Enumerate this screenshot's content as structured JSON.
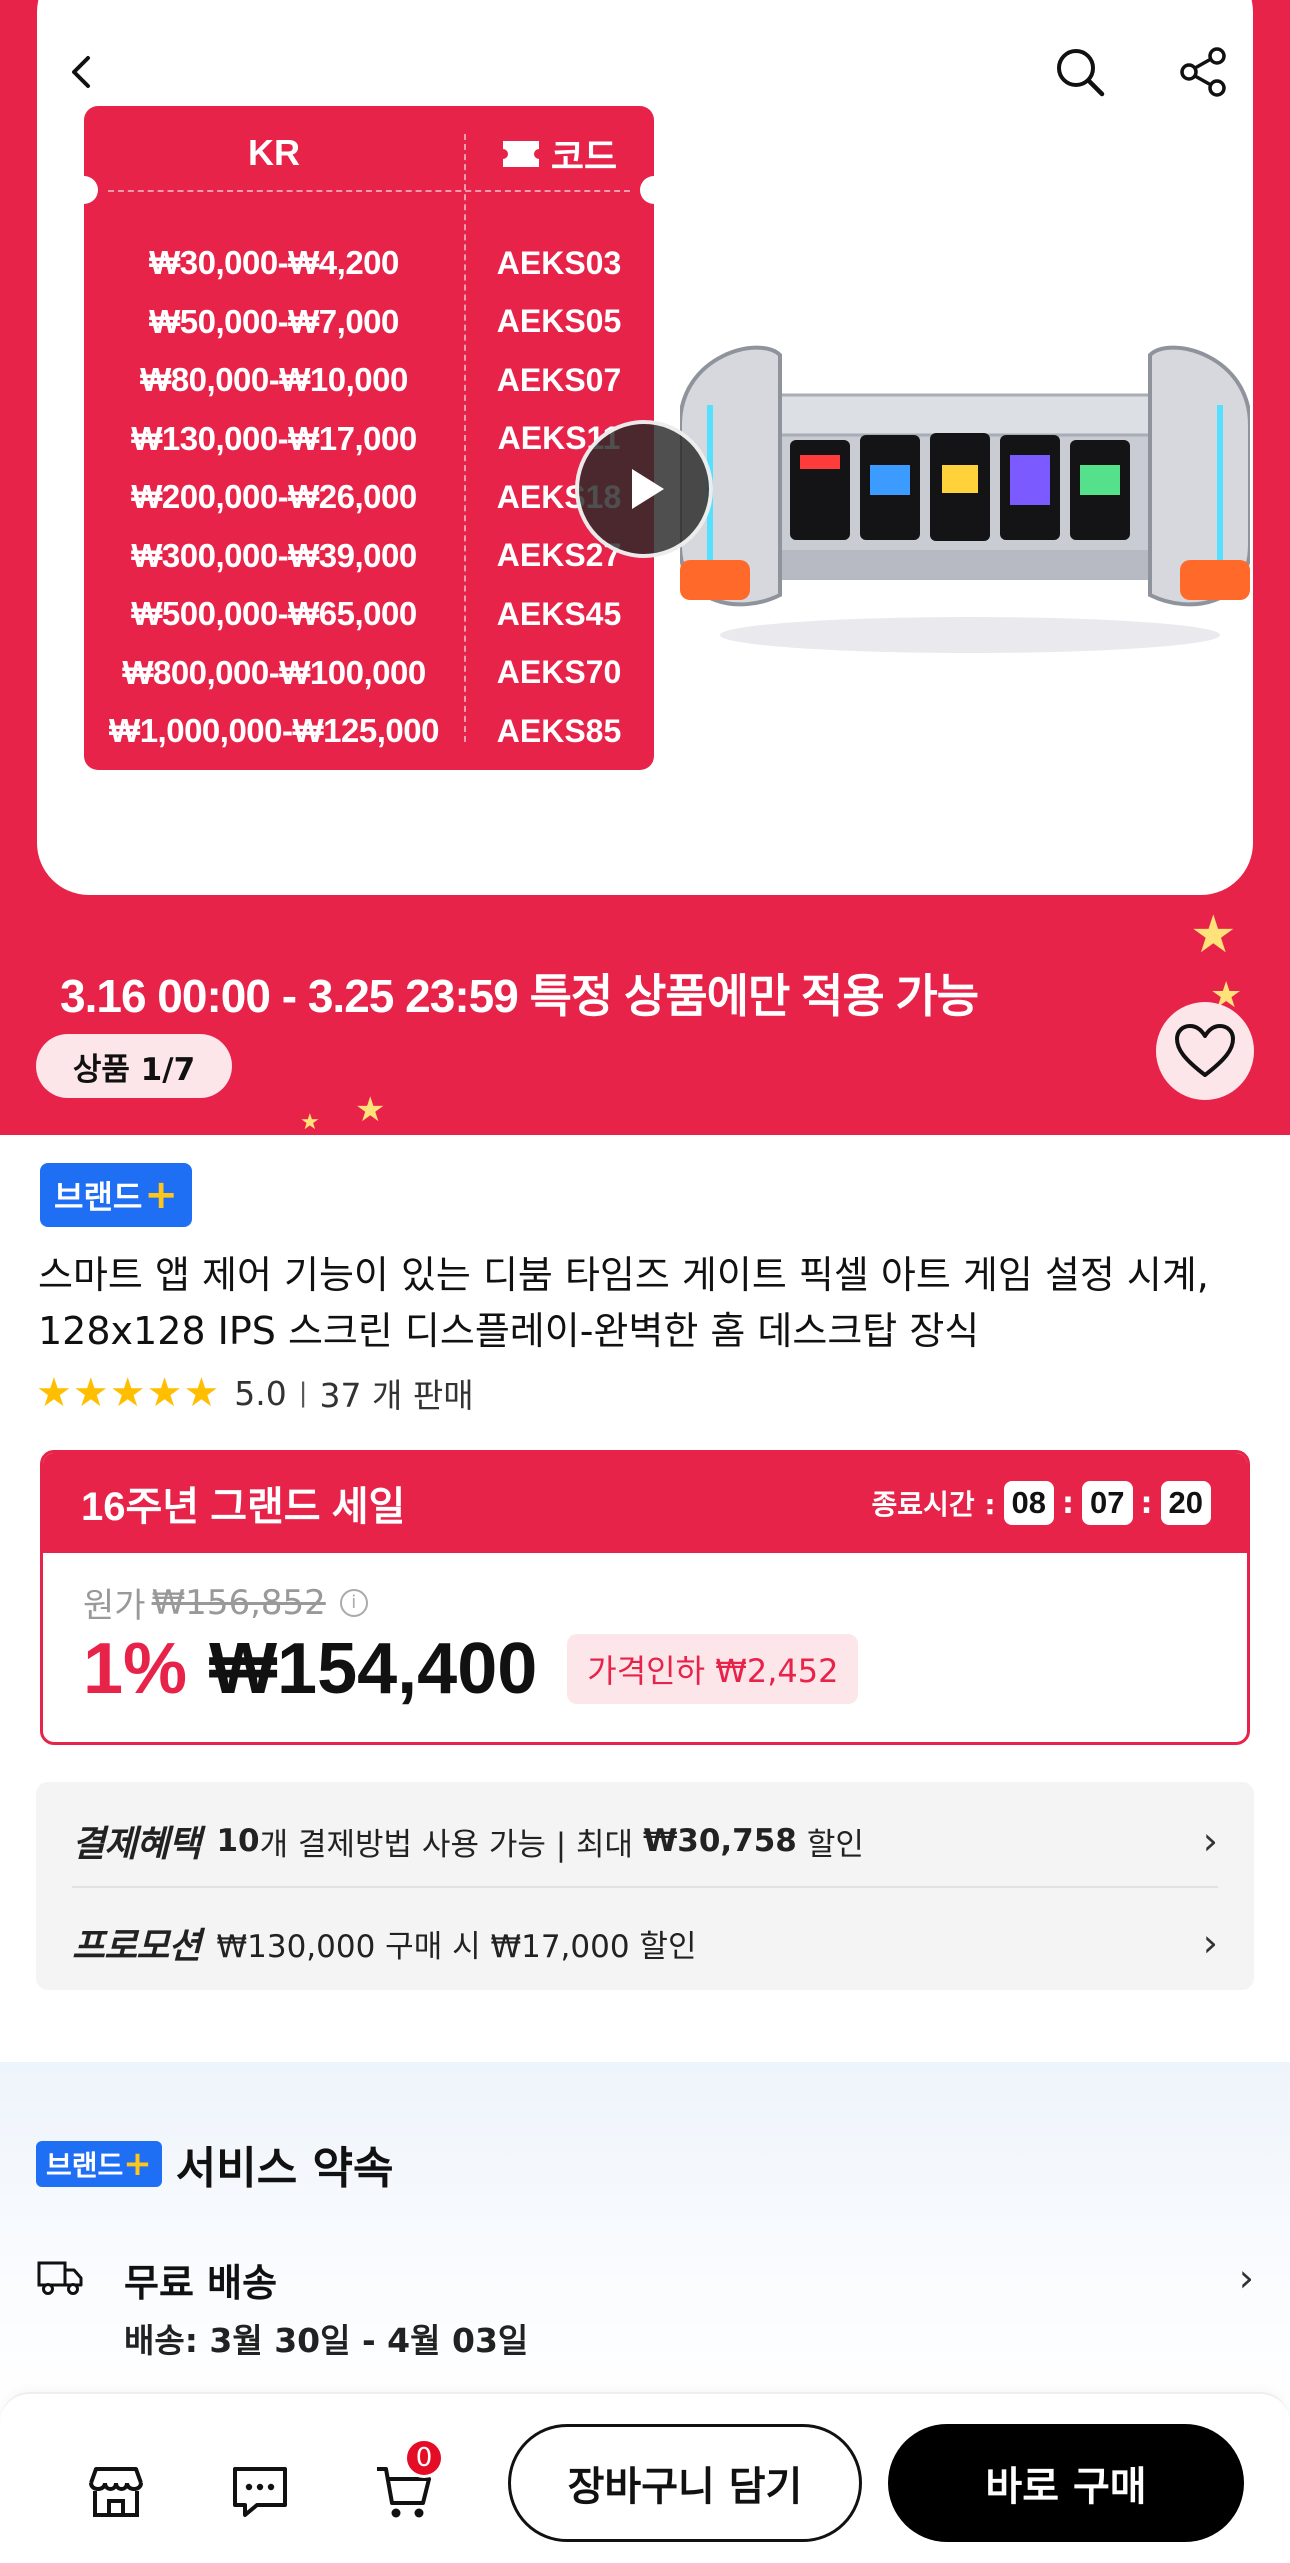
{
  "header": {
    "back_icon": "chevron-left-icon",
    "search_icon": "search-icon",
    "share_icon": "share-icon"
  },
  "coupon": {
    "header_region": "KR",
    "header_code": "코드",
    "rows": [
      {
        "range": "₩30,000-₩4,200",
        "code": "AEKS03"
      },
      {
        "range": "₩50,000-₩7,000",
        "code": "AEKS05"
      },
      {
        "range": "₩80,000-₩10,000",
        "code": "AEKS07"
      },
      {
        "range": "₩130,000-₩17,000",
        "code": "AEKS11"
      },
      {
        "range": "₩200,000-₩26,000",
        "code": "AEKS18"
      },
      {
        "range": "₩300,000-₩39,000",
        "code": "AEKS27"
      },
      {
        "range": "₩500,000-₩65,000",
        "code": "AEKS45"
      },
      {
        "range": "₩800,000-₩100,000",
        "code": "AEKS70"
      },
      {
        "range": "₩1,000,000-₩125,000",
        "code": "AEKS85"
      }
    ]
  },
  "banner": {
    "promo_text": "3.16 00:00 - 3.25 23:59 특정 상품에만 적용 가능",
    "image_counter": "상품 1/7"
  },
  "product": {
    "brand_badge": "브랜드",
    "title": "스마트 앱 제어 기능이 있는 디붐 타임즈 게이트 픽셀 아트 게임 설정 시계, 128x128 IPS 스크린 디스플레이-완벽한 홈 데스크탑 장식",
    "rating_stars": 5,
    "rating_value": "5.0",
    "sold": "37 개 판매"
  },
  "sale": {
    "title": "16주년 그랜드 세일",
    "timer_label": "종료시간 :",
    "timer": {
      "h": "08",
      "m": "07",
      "s": "20"
    },
    "original_label": "원가",
    "original_price": "₩156,852",
    "discount_pct": "1%",
    "price": "₩154,400",
    "price_drop": "가격인하 ₩2,452"
  },
  "benefits": {
    "payment_label": "결제혜택",
    "payment_count": "10",
    "payment_text": "개 결제방법 사용 가능 | 최대",
    "payment_max": "₩30,758",
    "payment_suffix": "할인",
    "promotion_label": "프로모션",
    "promotion_text": "₩130,000 구매 시 ₩17,000 할인"
  },
  "service": {
    "badge": "브랜드",
    "title": "서비스 약속",
    "shipping_title": "무료 배송",
    "shipping_sub": "배송: 3월 30일 - 4월 03일"
  },
  "bottom_bar": {
    "cart_count": "0",
    "add_to_cart": "장바구니 담기",
    "buy_now": "바로 구매"
  },
  "colors": {
    "accent": "#e8234a",
    "brand_blue": "#1f6ff5",
    "star": "#ffbf00"
  }
}
